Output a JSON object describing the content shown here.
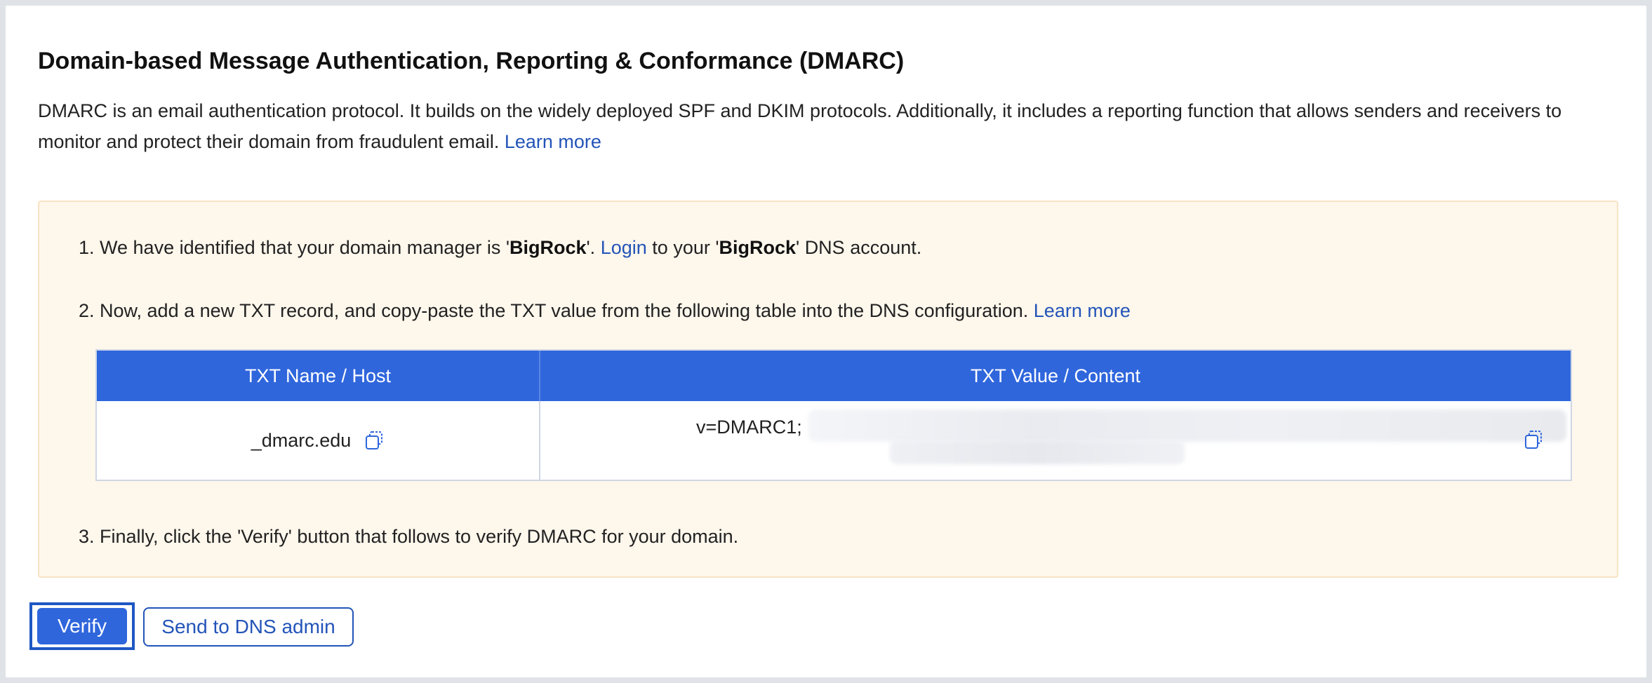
{
  "header": {
    "title": "Domain-based Message Authentication, Reporting & Conformance (DMARC)",
    "description": "DMARC is an email authentication protocol. It builds on the widely deployed SPF and DKIM protocols. Additionally, it includes a reporting function that allows senders and receivers to monitor and protect their domain from fraudulent email.",
    "learn_more": "Learn more"
  },
  "steps": {
    "step1": {
      "prefix": "1. We have identified that your domain manager is '",
      "manager": "BigRock",
      "mid": "'.",
      "login_link": "Login",
      "mid2": "to your '",
      "manager2": "BigRock",
      "suffix": "' DNS account."
    },
    "step2": {
      "text": "2. Now, add a new TXT record, and copy-paste the TXT value from the following table into the DNS configuration.",
      "learn_more": "Learn more"
    },
    "step3": {
      "text": "3. Finally, click the 'Verify' button that follows to verify DMARC for your domain."
    }
  },
  "table": {
    "headers": [
      "TXT Name / Host",
      "TXT Value / Content"
    ],
    "host": "_dmarc.edu",
    "value_visible": "v=DMARC1;"
  },
  "actions": {
    "verify": "Verify",
    "send_to_admin": "Send to DNS admin"
  },
  "colors": {
    "accent": "#2f66dc",
    "link": "#2354b8",
    "panel_bg": "#fef7ec"
  },
  "icons": {
    "copy": "copy-icon"
  }
}
